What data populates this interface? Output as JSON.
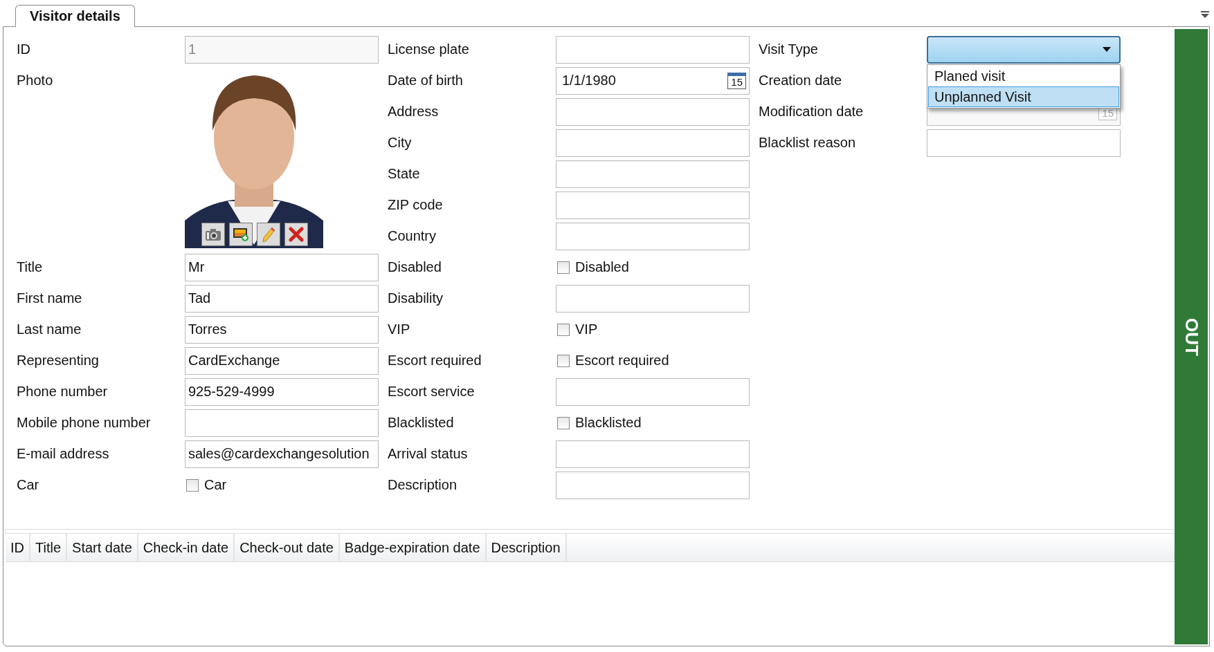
{
  "tabs": [
    {
      "label": "Visitor details",
      "selected": true
    }
  ],
  "form": {
    "columns": [
      {
        "rows": [
          {
            "kind": "text",
            "label": "ID",
            "value": "1",
            "disabled": true
          },
          {
            "label": "Photo"
          },
          {
            "kind": "text",
            "label": "Title",
            "value": "Mr"
          },
          {
            "kind": "text",
            "label": "First name",
            "value": "Tad"
          },
          {
            "kind": "text",
            "label": "Last name",
            "value": "Torres"
          },
          {
            "kind": "text",
            "label": "Representing",
            "value": "CardExchange"
          },
          {
            "kind": "text",
            "label": "Phone number",
            "value": "925-529-4999"
          },
          {
            "kind": "text",
            "label": "Mobile phone number"
          },
          {
            "kind": "text",
            "label": "E-mail address",
            "value": "sales@cardexchangesolution"
          },
          {
            "kind": "checkbox",
            "label": "Car",
            "text": "Car",
            "checked": false
          }
        ]
      },
      {
        "rows": [
          {
            "kind": "text",
            "label": "License plate"
          },
          {
            "kind": "date",
            "label": "Date of birth",
            "value": "1/1/1980",
            "day": "15"
          },
          {
            "kind": "text",
            "label": "Address"
          },
          {
            "kind": "text",
            "label": "City"
          },
          {
            "kind": "text",
            "label": "State"
          },
          {
            "kind": "text",
            "label": "ZIP code"
          },
          {
            "kind": "text",
            "label": "Country"
          },
          {
            "kind": "checkbox",
            "label": "Disabled",
            "text": "Disabled",
            "checked": false
          },
          {
            "kind": "text",
            "label": "Disability"
          },
          {
            "kind": "checkbox",
            "label": "VIP",
            "text": "VIP",
            "checked": false
          },
          {
            "kind": "checkbox",
            "label": "Escort required",
            "text": "Escort required",
            "checked": false
          },
          {
            "kind": "text",
            "label": "Escort service"
          },
          {
            "kind": "checkbox",
            "label": "Blacklisted",
            "text": "Blacklisted",
            "checked": false
          },
          {
            "kind": "text",
            "label": "Arrival status"
          },
          {
            "kind": "text",
            "label": "Description"
          }
        ]
      },
      {
        "rows": [
          {
            "kind": "select",
            "label": "Visit Type",
            "expanded": true,
            "options": [
              {
                "label": "Planed visit",
                "selected": false
              },
              {
                "label": "Unplanned Visit",
                "selected": true
              }
            ]
          },
          {
            "kind": "label",
            "label": "Creation date"
          },
          {
            "kind": "date",
            "label": "Modification date",
            "day": "15",
            "disabled": true
          },
          {
            "kind": "text",
            "label": "Blacklist reason"
          }
        ]
      }
    ]
  },
  "table": {
    "columns": [
      "ID",
      "Title",
      "Start date",
      "Check-in date",
      "Check-out date",
      "Badge-expiration date",
      "Description"
    ]
  },
  "status_button": {
    "label": "OUT"
  }
}
